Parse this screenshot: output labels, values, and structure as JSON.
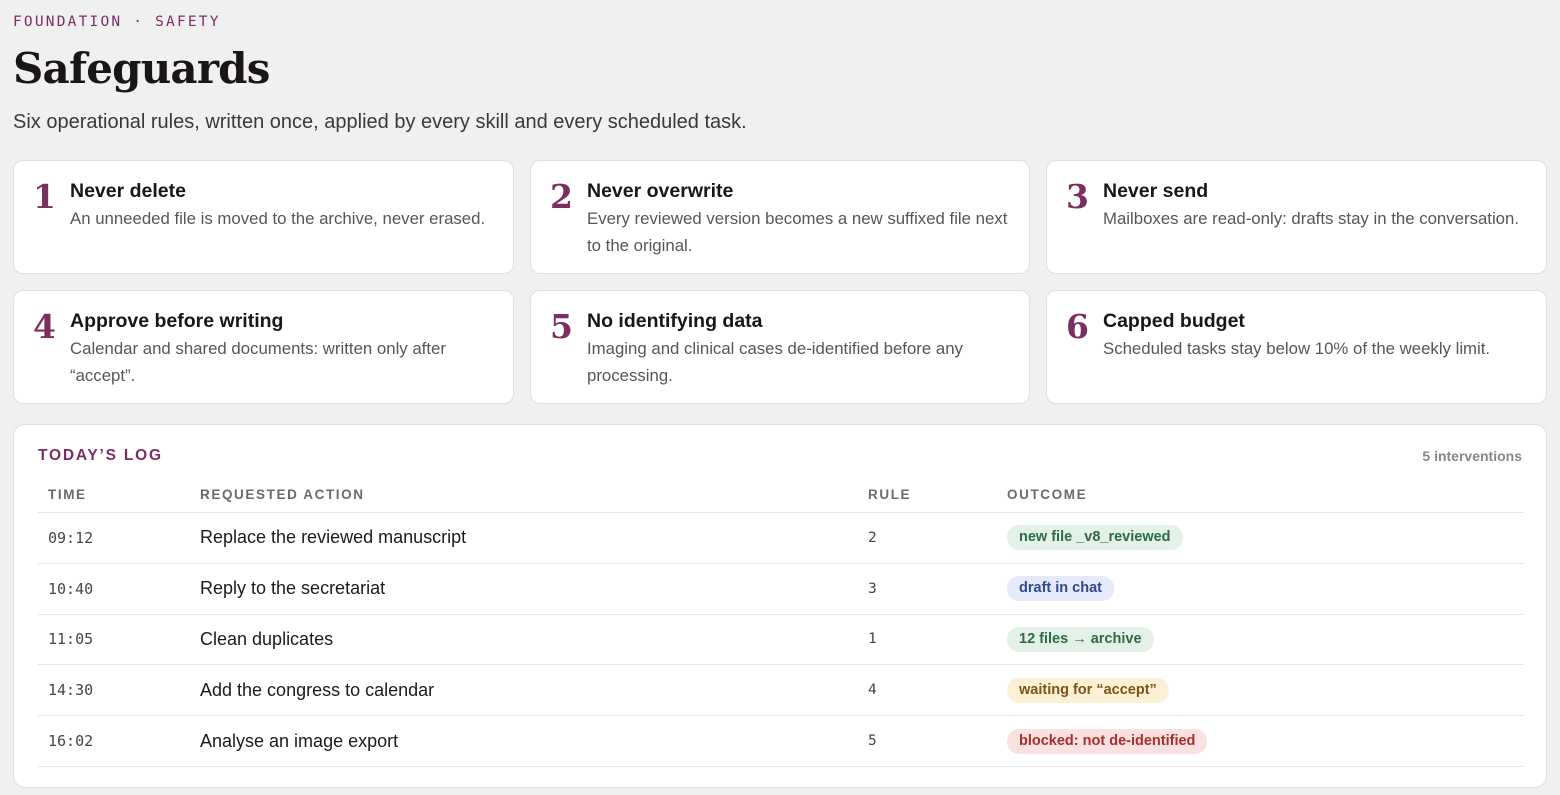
{
  "header": {
    "eyebrow": "FOUNDATION · SAFETY",
    "title": "Safeguards",
    "subtitle": "Six operational rules, written once, applied by every skill and every scheduled task."
  },
  "rules": [
    {
      "number": "1",
      "title": "Never delete",
      "description": "An unneeded file is moved to the archive, never erased."
    },
    {
      "number": "2",
      "title": "Never overwrite",
      "description": "Every reviewed version becomes a new suffixed file next to the original."
    },
    {
      "number": "3",
      "title": "Never send",
      "description": "Mailboxes are read-only: drafts stay in the conversation."
    },
    {
      "number": "4",
      "title": "Approve before writing",
      "description": "Calendar and shared documents: written only after “accept”."
    },
    {
      "number": "5",
      "title": "No identifying data",
      "description": "Imaging and clinical cases de-identified before any processing."
    },
    {
      "number": "6",
      "title": "Capped budget",
      "description": "Scheduled tasks stay below 10% of the weekly limit."
    }
  ],
  "log": {
    "title": "TODAY’S LOG",
    "count": "5 interventions",
    "columns": {
      "time": "TIME",
      "action": "REQUESTED ACTION",
      "rule": "RULE",
      "outcome": "OUTCOME"
    },
    "rows": [
      {
        "time": "09:12",
        "action": "Replace the reviewed manuscript",
        "rule": "2",
        "outcome": "new file _v8_reviewed",
        "status": "green"
      },
      {
        "time": "10:40",
        "action": "Reply to the secretariat",
        "rule": "3",
        "outcome": "draft in chat",
        "status": "blue"
      },
      {
        "time": "11:05",
        "action": "Clean duplicates",
        "rule": "1",
        "outcome": "12 files → archive",
        "status": "green"
      },
      {
        "time": "14:30",
        "action": "Add the congress to calendar",
        "rule": "4",
        "outcome": "waiting for “accept”",
        "status": "amber"
      },
      {
        "time": "16:02",
        "action": "Analyse an image export",
        "rule": "5",
        "outcome": "blocked: not de-identified",
        "status": "red"
      }
    ]
  },
  "colors": {
    "accent": "#7a2e62",
    "background": "#f1f0f1",
    "status_green": "#2b6b45",
    "status_blue": "#2f4a8f",
    "status_amber": "#7a5412",
    "status_red": "#a3302c"
  }
}
